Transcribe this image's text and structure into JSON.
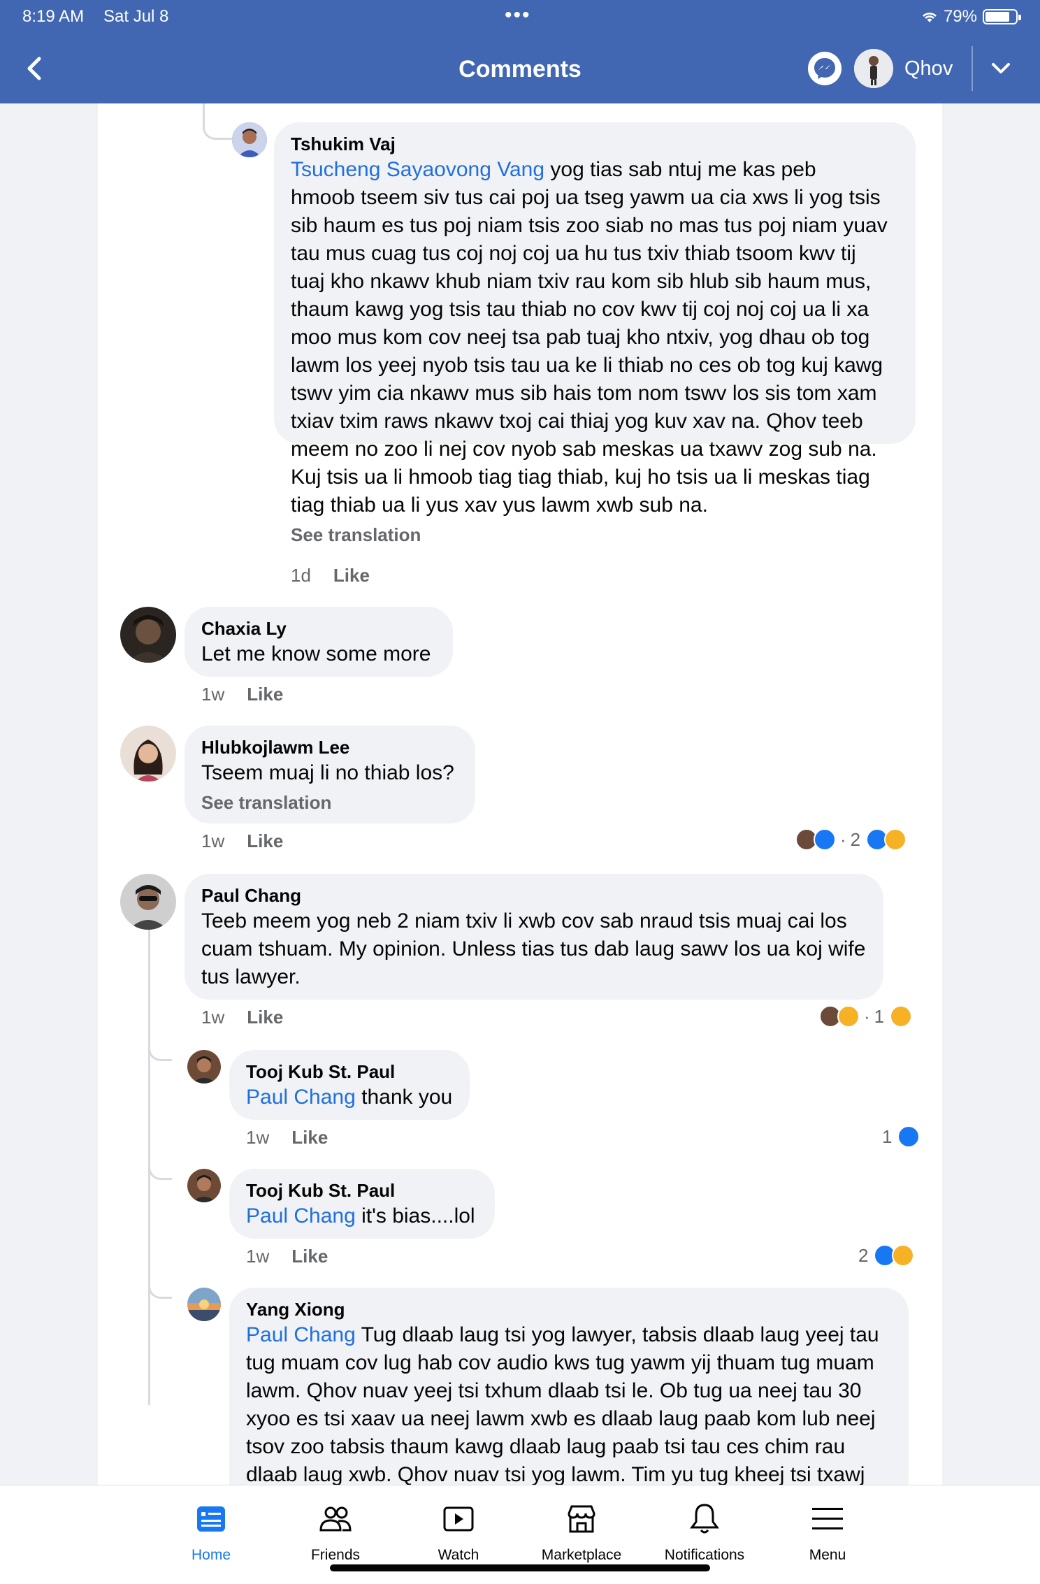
{
  "status_bar": {
    "time": "8:19 AM",
    "date": "Sat Jul 8",
    "battery": "79%"
  },
  "header": {
    "title": "Comments",
    "user_name": "Qhov"
  },
  "comments": [
    {
      "author": "Tshukim Vaj",
      "mention": "Tsucheng Sayaovong Vang",
      "text": "yog tias sab ntuj me kas peb\nhmoob tseem siv tus cai poj ua tseg yawm ua cia xws li yog tsis\nsib haum es tus poj niam tsis zoo siab no mas tus poj niam yuav\ntau mus cuag tus coj noj coj ua hu tus txiv thiab tsoom kwv tij\ntuaj kho nkawv khub niam txiv rau kom sib hlub sib haum mus,\nthaum kawg yog tsis tau thiab no cov kwv tij coj noj coj ua li xa\nmoo mus kom cov neej tsa pab tuaj kho ntxiv, yog dhau ob tog\nlawm los yeej nyob tsis tau ua ke li thiab no ces ob tog kuj kawg\ntswv yim cia nkawv mus sib hais tom nom tswv los sis tom xam\ntxiav txim raws nkawv txoj cai thiaj yog kuv xav na. Qhov teeb\nmeem no zoo li nej cov nyob sab meskas ua txawv zog sub na.\nKuj tsis ua li hmoob tiag tiag thiab, kuj ho tsis ua li meskas tiag\ntiag thiab  ua li yus xav yus lawm xwb sub na.",
      "see_translation": "See translation",
      "time": "1d",
      "like": "Like"
    },
    {
      "author": "Chaxia Ly",
      "text": "Let me know some more",
      "time": "1w",
      "like": "Like"
    },
    {
      "author": "Hlubkojlawm Lee",
      "text": "Tseem muaj li no thiab los?",
      "see_translation": "See translation",
      "time": "1w",
      "like": "Like",
      "reaction_count": "2"
    },
    {
      "author": "Paul Chang",
      "text": "Teeb meem yog neb 2 niam txiv li xwb cov sab nraud tsis muaj cai los\ncuam tshuam. My opinion. Unless tias tus dab laug sawv los ua koj wife\ntus lawyer.",
      "time": "1w",
      "like": "Like",
      "reaction_count": "1"
    },
    {
      "author": "Tooj Kub St. Paul",
      "mention": "Paul Chang",
      "text": " thank you",
      "time": "1w",
      "like": "Like",
      "reaction_count": "1"
    },
    {
      "author": "Tooj Kub St. Paul",
      "mention": "Paul Chang",
      "text": " it's bias....lol",
      "time": "1w",
      "like": "Like",
      "reaction_count": "2"
    },
    {
      "author": "Yang Xiong",
      "mention": "Paul Chang",
      "text": " Tug dlaab laug tsi yog lawyer, tabsis dlaab laug yeej tau\ntug muam cov lug hab cov audio kws tug yawm yij thuam tug muam\nlawm.  Qhov nuav yeej tsi txhum dlaab tsi le.  Ob tug ua neej tau 30\nxyoo es tsi xaav ua neej lawm xwb es dlaab laug paab kom lub neej\ntsov zoo tabsis thaum kawg dlaab laug paab tsi tau ces chim rau\ndlaab laug xwb.  Qhov nuav tsi yog lawm.  Tim yu tug kheej tsi txawj"
    }
  ],
  "tabbar": {
    "items": [
      {
        "label": "Home",
        "icon": "home-icon",
        "active": true
      },
      {
        "label": "Friends",
        "icon": "friends-icon"
      },
      {
        "label": "Watch",
        "icon": "watch-icon"
      },
      {
        "label": "Marketplace",
        "icon": "marketplace-icon"
      },
      {
        "label": "Notifications",
        "icon": "notifications-icon"
      },
      {
        "label": "Menu",
        "icon": "menu-icon"
      }
    ]
  },
  "colors": {
    "brand": "#4267b2",
    "link": "#216fdb",
    "active_tab": "#1877f2",
    "bubble": "#f0f2f5",
    "meta": "#65676b"
  }
}
